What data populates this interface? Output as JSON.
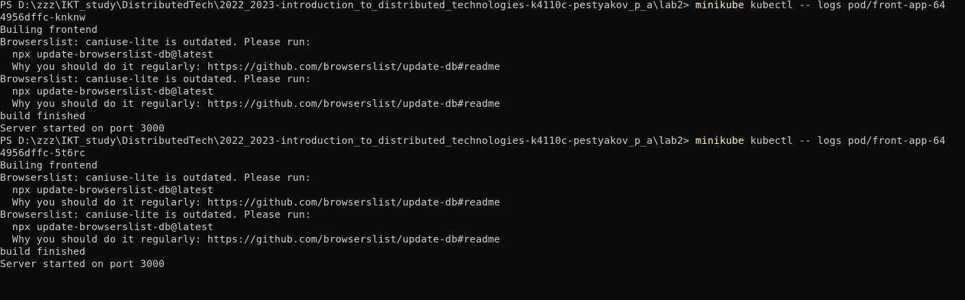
{
  "terminal": {
    "colors": {
      "background": "#0c0c0c",
      "text": "#cccccc",
      "command_highlight": "#f9f1a5"
    },
    "blocks": [
      {
        "prompt": "PS D:\\zzz\\IKT_study\\DistributedTech\\2022_2023-introduction_to_distributed_technologies-k4110c-pestyakov_p_a\\lab2> ",
        "command_exe": "minikube",
        "command_args": " kubectl -- logs pod/front-app-64",
        "command_wrap": "4956dffc-knknw",
        "output": [
          "Builing frontend",
          "Browserslist: caniuse-lite is outdated. Please run:",
          "  npx update-browserslist-db@latest",
          "  Why you should do it regularly: https://github.com/browserslist/update-db#readme",
          "Browserslist: caniuse-lite is outdated. Please run:",
          "  npx update-browserslist-db@latest",
          "  Why you should do it regularly: https://github.com/browserslist/update-db#readme",
          "build finished",
          "Server started on port 3000"
        ]
      },
      {
        "prompt": "PS D:\\zzz\\IKT_study\\DistributedTech\\2022_2023-introduction_to_distributed_technologies-k4110c-pestyakov_p_a\\lab2> ",
        "command_exe": "minikube",
        "command_args": " kubectl -- logs pod/front-app-64",
        "command_wrap": "4956dffc-5t6rc",
        "output": [
          "Builing frontend",
          "Browserslist: caniuse-lite is outdated. Please run:",
          "  npx update-browserslist-db@latest",
          "  Why you should do it regularly: https://github.com/browserslist/update-db#readme",
          "Browserslist: caniuse-lite is outdated. Please run:",
          "  npx update-browserslist-db@latest",
          "  Why you should do it regularly: https://github.com/browserslist/update-db#readme",
          "build finished",
          "Server started on port 3000"
        ]
      }
    ]
  }
}
